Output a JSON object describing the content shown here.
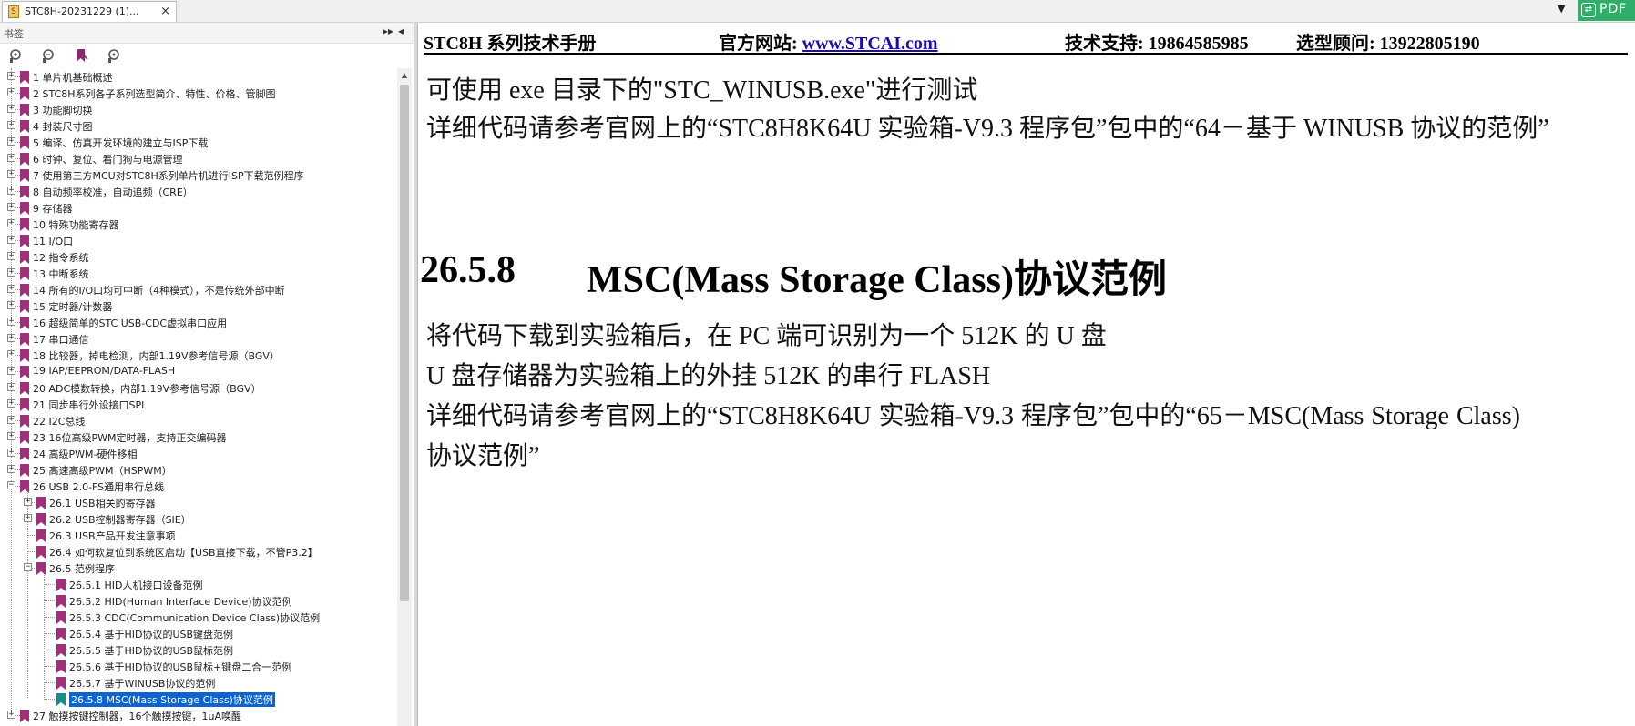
{
  "tab": {
    "icon": "pdf-file-icon",
    "title": "STC8H-20231229 (1)...",
    "close": "×"
  },
  "tabbar": {
    "chevron": "▼",
    "badge_icon": "⇄",
    "badge_text": "PDF"
  },
  "panel": {
    "title": "书签",
    "ctrl_expand": "▸▸",
    "ctrl_collapse": "◂",
    "toolbar": [
      "bookmark-expand-icon",
      "bookmark-collapse-icon",
      "bookmark-add-icon",
      "bookmark-find-icon"
    ],
    "bookmarks": [
      {
        "label": "1 单片机基础概述",
        "level": 0,
        "exp": "+"
      },
      {
        "label": "2  STC8H系列各子系列选型简介、特性、价格、管脚图",
        "level": 0,
        "exp": "+"
      },
      {
        "label": "3  功能脚切换",
        "level": 0,
        "exp": "+"
      },
      {
        "label": "4  封装尺寸图",
        "level": 0,
        "exp": "+"
      },
      {
        "label": "5  编译、仿真开发环境的建立与ISP下载",
        "level": 0,
        "exp": "+"
      },
      {
        "label": "6  时钟、复位、看门狗与电源管理",
        "level": 0,
        "exp": "+"
      },
      {
        "label": "7  使用第三方MCU对STC8H系列单片机进行ISP下载范例程序",
        "level": 0,
        "exp": "+"
      },
      {
        "label": "8  自动频率校准，自动追频（CRE）",
        "level": 0,
        "exp": "+"
      },
      {
        "label": "9  存储器",
        "level": 0,
        "exp": "+"
      },
      {
        "label": "10  特殊功能寄存器",
        "level": 0,
        "exp": "+"
      },
      {
        "label": "11  I/O口",
        "level": 0,
        "exp": "+"
      },
      {
        "label": "12  指令系统",
        "level": 0,
        "exp": "+"
      },
      {
        "label": "13  中断系统",
        "level": 0,
        "exp": "+"
      },
      {
        "label": "14  所有的I/O口均可中断（4种模式），不是传统外部中断",
        "level": 0,
        "exp": "+"
      },
      {
        "label": "15  定时器/计数器",
        "level": 0,
        "exp": "+"
      },
      {
        "label": "16  超级简单的STC USB-CDC虚拟串口应用",
        "level": 0,
        "exp": "+"
      },
      {
        "label": "17  串口通信",
        "level": 0,
        "exp": "+"
      },
      {
        "label": "18  比较器，掉电检测，内部1.19V参考信号源（BGV）",
        "level": 0,
        "exp": "+"
      },
      {
        "label": "19  IAP/EEPROM/DATA-FLASH",
        "level": 0,
        "exp": "+"
      },
      {
        "label": "20  ADC模数转换，内部1.19V参考信号源（BGV）",
        "level": 0,
        "exp": "+"
      },
      {
        "label": "21  同步串行外设接口SPI",
        "level": 0,
        "exp": "+"
      },
      {
        "label": "22  I2C总线",
        "level": 0,
        "exp": "+"
      },
      {
        "label": "23  16位高级PWM定时器，支持正交编码器",
        "level": 0,
        "exp": "+"
      },
      {
        "label": "24  高级PWM-硬件移相",
        "level": 0,
        "exp": "+"
      },
      {
        "label": "25  高速高级PWM（HSPWM）",
        "level": 0,
        "exp": "+"
      },
      {
        "label": "26  USB 2.0-FS通用串行总线",
        "level": 0,
        "exp": "−"
      },
      {
        "label": "26.1  USB相关的寄存器",
        "level": 1,
        "exp": "+"
      },
      {
        "label": "26.2  USB控制器寄存器（SIE）",
        "level": 1,
        "exp": "+"
      },
      {
        "label": "26.3 USB产品开发注意事项",
        "level": 1,
        "exp": ""
      },
      {
        "label": "26.4  如何软复位到系统区启动【USB直接下载，不管P3.2】",
        "level": 1,
        "exp": ""
      },
      {
        "label": "26.5  范例程序",
        "level": 1,
        "exp": "−"
      },
      {
        "label": "26.5.1 HID人机接口设备范例",
        "level": 2,
        "exp": ""
      },
      {
        "label": "26.5.2  HID(Human Interface Device)协议范例",
        "level": 2,
        "exp": ""
      },
      {
        "label": "26.5.3 CDC(Communication Device Class)协议范例",
        "level": 2,
        "exp": ""
      },
      {
        "label": "26.5.4 基于HID协议的USB键盘范例",
        "level": 2,
        "exp": ""
      },
      {
        "label": "26.5.5 基于HID协议的USB鼠标范例",
        "level": 2,
        "exp": ""
      },
      {
        "label": "26.5.6 基于HID协议的USB鼠标+键盘二合一范例",
        "level": 2,
        "exp": ""
      },
      {
        "label": "26.5.7 基于WINUSB协议的范例",
        "level": 2,
        "exp": ""
      },
      {
        "label": "26.5.8 MSC(Mass Storage Class)协议范例",
        "level": 2,
        "exp": "",
        "selected": true
      },
      {
        "label": "27  触摸按键控制器，16个触摸按键，1uA唤醒",
        "level": 0,
        "exp": "+"
      }
    ]
  },
  "doc": {
    "header": {
      "title": "STC8H 系列技术手册",
      "website_label": "官方网站: ",
      "website_link": "www.STCAI.com",
      "support": "技术支持: 19864585985",
      "advisor": "选型顾问: 13922805190"
    },
    "lines_top": [
      "可使用 exe 目录下的\"STC_WINUSB.exe\"进行测试",
      "详细代码请参考官网上的“STC8H8K64U 实验箱-V9.3 程序包”包中的“64－基于 WINUSB 协议的范例”"
    ],
    "section_number": "26.5.8",
    "section_title": "MSC(Mass Storage Class)协议范例",
    "lines_body": [
      "将代码下载到实验箱后，在 PC 端可识别为一个 512K 的 U 盘",
      "U 盘存储器为实验箱上的外挂 512K 的串行 FLASH",
      "详细代码请参考官网上的“STC8H8K64U 实验箱-V9.3 程序包”包中的“65－MSC(Mass Storage Class)",
      "协议范例”"
    ]
  },
  "colors": {
    "selection": "#0b64d0",
    "bookmark_icon": "#a0307a",
    "bookmark_icon_selected": "#1a8a8a",
    "pdf_badge": "#2fae6a"
  }
}
